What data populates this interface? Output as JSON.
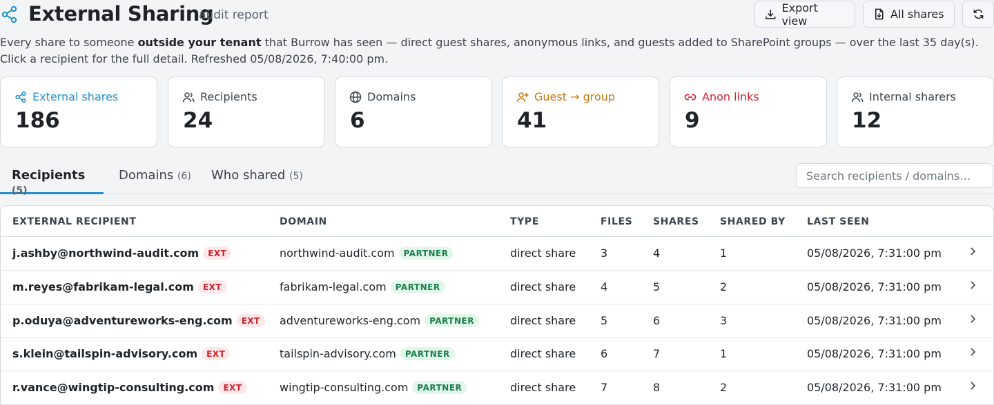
{
  "header": {
    "title": "External Sharing",
    "subtitle": "audit report",
    "export_label": "Export view",
    "all_shares_label": "All shares"
  },
  "description": {
    "part1": "Every share to someone ",
    "bold": "outside your tenant",
    "part2": " that Burrow has seen — direct guest shares, anonymous links, and guests added to SharePoint groups — over the last 35 day(s). Click a recipient for the full detail. Refreshed 05/08/2026, 7:40:00 pm."
  },
  "stats": [
    {
      "label": "External shares",
      "value": "186",
      "icon": "share-icon",
      "color": "#1f8fcf"
    },
    {
      "label": "Recipients",
      "value": "24",
      "icon": "users-icon"
    },
    {
      "label": "Domains",
      "value": "6",
      "icon": "globe-icon"
    },
    {
      "label": "Guest → group",
      "value": "41",
      "icon": "user-plus-icon",
      "color": "#c7770a"
    },
    {
      "label": "Anon links",
      "value": "9",
      "icon": "link-icon",
      "color": "#d1242f"
    },
    {
      "label": "Internal sharers",
      "value": "12",
      "icon": "users-icon"
    }
  ],
  "tabs": [
    {
      "label": "Recipients",
      "count": "(5)",
      "active": true
    },
    {
      "label": "Domains",
      "count": "(6)"
    },
    {
      "label": "Who shared",
      "count": "(5)"
    }
  ],
  "search": {
    "placeholder": "Search recipients / domains…"
  },
  "table": {
    "columns": [
      "EXTERNAL RECIPIENT",
      "DOMAIN",
      "TYPE",
      "FILES",
      "SHARES",
      "SHARED BY",
      "LAST SEEN"
    ],
    "rows": [
      {
        "recipient": "j.ashby@northwind-audit.com",
        "recipient_badge": "EXT",
        "domain": "northwind-audit.com",
        "domain_badge": "PARTNER",
        "type": "direct share",
        "files": "3",
        "shares": "4",
        "shared_by": "1",
        "last_seen": "05/08/2026, 7:31:00 pm"
      },
      {
        "recipient": "m.reyes@fabrikam-legal.com",
        "recipient_badge": "EXT",
        "domain": "fabrikam-legal.com",
        "domain_badge": "PARTNER",
        "type": "direct share",
        "files": "4",
        "shares": "5",
        "shared_by": "2",
        "last_seen": "05/08/2026, 7:31:00 pm"
      },
      {
        "recipient": "p.oduya@adventureworks-eng.com",
        "recipient_badge": "EXT",
        "domain": "adventureworks-eng.com",
        "domain_badge": "PARTNER",
        "type": "direct share",
        "files": "5",
        "shares": "6",
        "shared_by": "3",
        "last_seen": "05/08/2026, 7:31:00 pm"
      },
      {
        "recipient": "s.klein@tailspin-advisory.com",
        "recipient_badge": "EXT",
        "domain": "tailspin-advisory.com",
        "domain_badge": "PARTNER",
        "type": "direct share",
        "files": "6",
        "shares": "7",
        "shared_by": "1",
        "last_seen": "05/08/2026, 7:31:00 pm"
      },
      {
        "recipient": "r.vance@wingtip-consulting.com",
        "recipient_badge": "EXT",
        "domain": "wingtip-consulting.com",
        "domain_badge": "PARTNER",
        "type": "direct share",
        "files": "7",
        "shares": "8",
        "shared_by": "2",
        "last_seen": "05/08/2026, 7:31:00 pm"
      }
    ]
  }
}
